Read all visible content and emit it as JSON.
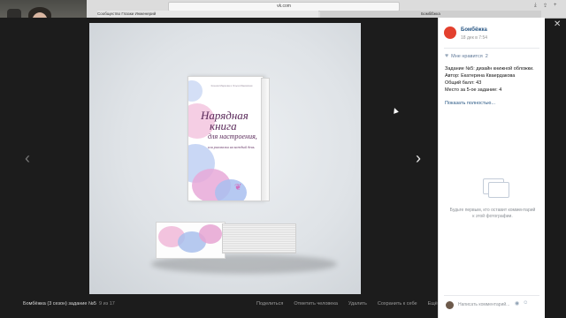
{
  "browser": {
    "address": "vk.com",
    "tab_left": "Сообщество Глазки Инженерий",
    "tab_right": "БомбЁжка"
  },
  "viewer": {
    "prev_icon": "chevron-left-icon",
    "next_icon": "chevron-right-icon",
    "album_title": "Бомбёжка (3 сезон) задание №5",
    "counter": "9 из 17",
    "actions": [
      "Поделиться",
      "Отметить человека",
      "Удалить",
      "Сохранить к себе",
      "Ещё ⌄"
    ]
  },
  "book": {
    "authors": "Ксения Маркова и Ольга Маковская",
    "title_line1": "Нарядная",
    "title_line2": "книга",
    "title_line3": "для настроения,",
    "subtitle": "или рисовалки на каждый день"
  },
  "panel": {
    "group_name": "Бомбёжка",
    "date": "18 дек в 7:54",
    "likes_label": "Мне нравится",
    "likes_count": "2",
    "desc_line1": "Задание №5: дизайн книжной обложки.",
    "desc_line2": "Автор: Екатерина Кваердакова",
    "desc_line3": "Общий балл: 43",
    "desc_line4": "Место за 5-ое задание: 4",
    "show_more": "Показать полностью...",
    "empty_comments": "Будьте первым, кто оставит комментарий к этой фотографии.",
    "write_placeholder": "Написать комментарий...",
    "close_icon": "close-icon"
  },
  "colors": {
    "link": "#2a5885",
    "accent": "#e3402e",
    "viewer_bg": "#1c1c1c"
  }
}
